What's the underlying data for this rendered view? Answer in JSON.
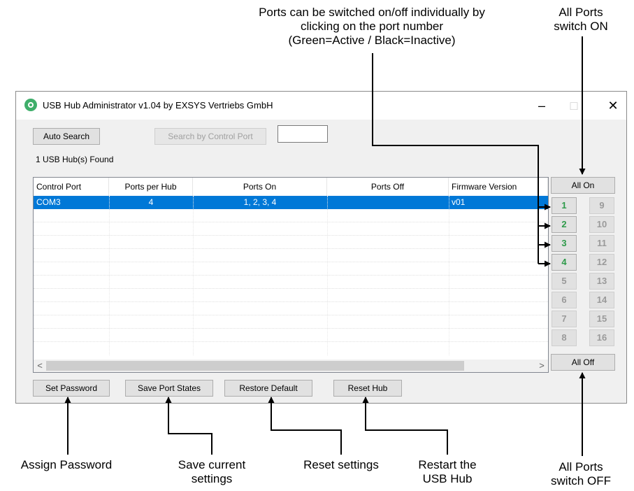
{
  "annotations": {
    "ports_individual": "Ports can be switched on/off individually by\nclicking on the port number\n(Green=Active / Black=Inactive)",
    "all_on": "All Ports\nswitch ON",
    "assign_password": "Assign Password",
    "save_current": "Save current\nsettings",
    "reset_settings": "Reset settings",
    "restart_hub": "Restart the\nUSB Hub",
    "all_off": "All Ports\nswitch OFF"
  },
  "window": {
    "title": "USB Hub Administrator v1.04 by EXSYS Vertriebs GmbH",
    "minimize": "–",
    "maximize": "□",
    "close": "✕"
  },
  "toolbar": {
    "auto_search": "Auto Search",
    "search_by_port": "Search by Control Port",
    "port_input_value": "",
    "hubs_found": "1 USB Hub(s) Found"
  },
  "table": {
    "columns": [
      "Control Port",
      "Ports per Hub",
      "Ports On",
      "Ports Off",
      "Firmware Version"
    ],
    "rows": [
      {
        "control_port": "COM3",
        "ports_per_hub": "4",
        "ports_on": "1, 2, 3, 4",
        "ports_off": "",
        "firmware": "v01"
      }
    ],
    "scroll_left": "<",
    "scroll_right": ">"
  },
  "ports": {
    "all_on": "All On",
    "all_off": "All Off",
    "left": [
      {
        "label": "1",
        "state": "on"
      },
      {
        "label": "2",
        "state": "on"
      },
      {
        "label": "3",
        "state": "on"
      },
      {
        "label": "4",
        "state": "on"
      },
      {
        "label": "5",
        "state": "off"
      },
      {
        "label": "6",
        "state": "off"
      },
      {
        "label": "7",
        "state": "off"
      },
      {
        "label": "8",
        "state": "off"
      }
    ],
    "right": [
      {
        "label": "9",
        "state": "off"
      },
      {
        "label": "10",
        "state": "off"
      },
      {
        "label": "11",
        "state": "off"
      },
      {
        "label": "12",
        "state": "off"
      },
      {
        "label": "13",
        "state": "off"
      },
      {
        "label": "14",
        "state": "off"
      },
      {
        "label": "15",
        "state": "off"
      },
      {
        "label": "16",
        "state": "off"
      }
    ]
  },
  "bottom": {
    "set_password": "Set Password",
    "save_port_states": "Save Port States",
    "restore_default": "Restore Default",
    "reset_hub": "Reset Hub"
  },
  "colors": {
    "selection": "#0078d7",
    "port_on": "#2e9a4a",
    "port_off": "#9a9a9a"
  }
}
